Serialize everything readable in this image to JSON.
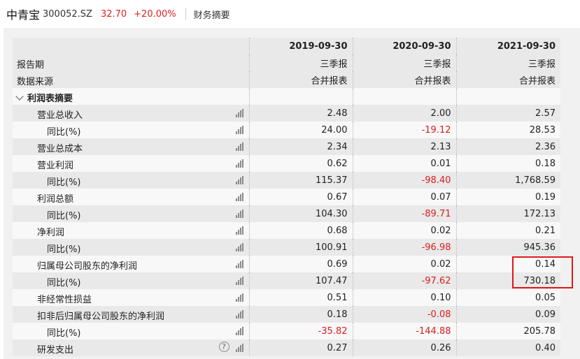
{
  "header": {
    "name": "中青宝",
    "code": "300052.SZ",
    "price": "32.70",
    "change": "+20.00%",
    "section": "财务摘要"
  },
  "columns": {
    "period_label": "报告期",
    "source_label": "数据来源",
    "dates": [
      "2019-09-30",
      "2020-09-30",
      "2021-09-30"
    ],
    "report_types": [
      "三季报",
      "三季报",
      "三季报"
    ],
    "sources": [
      "合并报表",
      "合并报表",
      "合并报表"
    ]
  },
  "section_title": "利润表摘要",
  "rows": [
    {
      "label": "营业总收入",
      "values": [
        "2.48",
        "2.00",
        "2.57"
      ]
    },
    {
      "label": "同比(%)",
      "values": [
        "24.00",
        "-19.12",
        "28.53"
      ]
    },
    {
      "label": "营业总成本",
      "values": [
        "2.34",
        "2.13",
        "2.36"
      ]
    },
    {
      "label": "营业利润",
      "values": [
        "0.62",
        "0.01",
        "0.18"
      ]
    },
    {
      "label": "同比(%)",
      "values": [
        "115.37",
        "-98.40",
        "1,768.59"
      ]
    },
    {
      "label": "利润总额",
      "values": [
        "0.67",
        "0.07",
        "0.19"
      ]
    },
    {
      "label": "同比(%)",
      "values": [
        "104.30",
        "-89.71",
        "172.13"
      ]
    },
    {
      "label": "净利润",
      "values": [
        "0.68",
        "0.02",
        "0.21"
      ]
    },
    {
      "label": "同比(%)",
      "values": [
        "100.91",
        "-96.98",
        "945.36"
      ]
    },
    {
      "label": "归属母公司股东的净利润",
      "values": [
        "0.69",
        "0.02",
        "0.14"
      ]
    },
    {
      "label": "同比(%)",
      "values": [
        "107.47",
        "-97.62",
        "730.18"
      ]
    },
    {
      "label": "非经常性损益",
      "values": [
        "0.51",
        "0.10",
        "0.05"
      ]
    },
    {
      "label": "扣非后归属母公司股东的净利润",
      "values": [
        "0.18",
        "-0.08",
        "0.09"
      ]
    },
    {
      "label": "同比(%)",
      "values": [
        "-35.82",
        "-144.88",
        "205.78"
      ]
    },
    {
      "label": "研发支出",
      "values": [
        "0.27",
        "0.26",
        "0.40"
      ]
    }
  ],
  "colors": {
    "up": "#e02020",
    "negative": "#d81e1e",
    "highlight_border": "#e01818"
  }
}
